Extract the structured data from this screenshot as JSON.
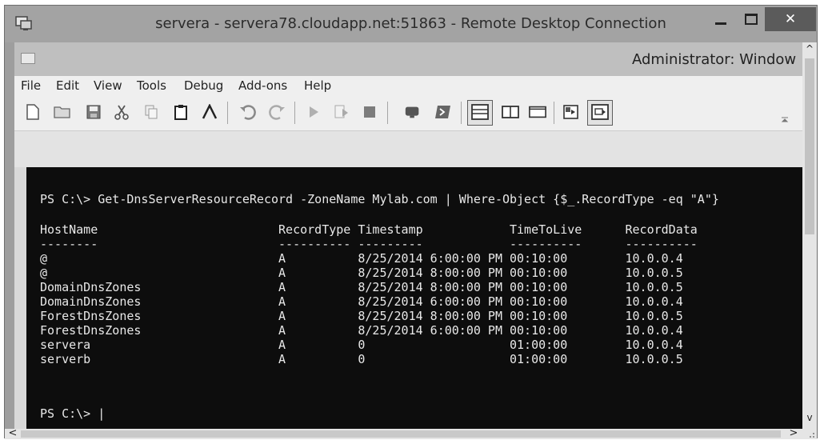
{
  "window": {
    "title": "servera - servera78.cloudapp.net:51863 - Remote Desktop Connection",
    "close_glyph": "✕"
  },
  "ise": {
    "title": "Administrator: Window"
  },
  "menu": [
    "File",
    "Edit",
    "View",
    "Tools",
    "Debug",
    "Add-ons",
    "Help"
  ],
  "toolbar": {
    "icons": [
      "new-script-icon",
      "open-icon",
      "save-icon",
      "cut-icon",
      "copy-icon",
      "paste-icon",
      "clear-console-icon",
      "undo-icon",
      "redo-icon",
      "run-icon",
      "run-selection-icon",
      "stop-icon",
      "remote-powershell-icon",
      "start-powershell-icon",
      "show-script-top-icon",
      "show-script-right-icon",
      "show-script-maximized-icon",
      "show-command-addon-icon",
      "show-script-pane-icon"
    ]
  },
  "console": {
    "command_line": "PS C:\\> Get-DnsServerResourceRecord -ZoneName Mylab.com | Where-Object {$_.RecordType -eq \"A\"}",
    "table_text": "HostName                         RecordType Timestamp            TimeToLive      RecordData\n--------                         ---------- ---------            ----------      ----------\n@                                A          8/25/2014 6:00:00 PM 00:10:00        10.0.0.4\n@                                A          8/25/2014 8:00:00 PM 00:10:00        10.0.0.5\nDomainDnsZones                   A          8/25/2014 8:00:00 PM 00:10:00        10.0.0.5\nDomainDnsZones                   A          8/25/2014 6:00:00 PM 00:10:00        10.0.0.4\nForestDnsZones                   A          8/25/2014 8:00:00 PM 00:10:00        10.0.0.5\nForestDnsZones                   A          8/25/2014 6:00:00 PM 00:10:00        10.0.0.4\nservera                          A          0                    01:00:00        10.0.0.4\nserverb                          A          0                    01:00:00        10.0.0.5",
    "prompt": "PS C:\\> |"
  },
  "scrollbars": {
    "up": "^",
    "down": "v",
    "left": "<",
    "right": ">"
  }
}
